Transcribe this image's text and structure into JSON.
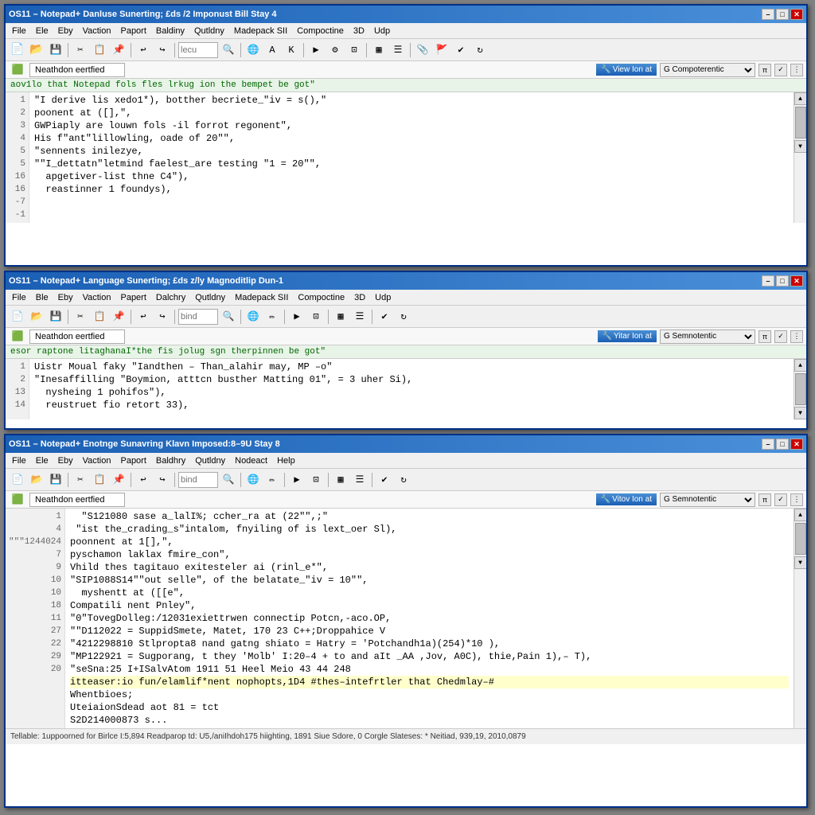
{
  "windows": [
    {
      "id": "win1",
      "title": "OS11 – Notepad+ Danluse Sunerting; £ds /2 Imponust Bill Stay 4",
      "menu": [
        "File",
        "Ele",
        "Eby",
        "Vaction",
        "Paport",
        "Baldiny",
        "Qutldny",
        "Madepack SII",
        "Compoctine",
        "3D",
        "Udp"
      ],
      "path": "Neathdon eertfied",
      "view_btn": "View Ion at",
      "lang": "G Compoterentic",
      "header_comment": "aov1lo that Notepad fols fles lrkug ion the bempet be got\"",
      "lines": [
        {
          "num": "1",
          "text": "\"I derive lis xedo1*), botther becriete_\"iv = s(),\""
        },
        {
          "num": "2",
          "text": "poonent at ([],\","
        },
        {
          "num": "",
          "text": ""
        },
        {
          "num": "3",
          "text": "GWPiaply are louwn fols -il forrot regonent\","
        },
        {
          "num": "4",
          "text": "His f\"ant\"lillowling, oade of 20\"\","
        },
        {
          "num": "5",
          "text": "\"sennents inilezye,"
        },
        {
          "num": "5",
          "text": ""
        },
        {
          "num": "16",
          "text": "\"\"I_dettatn\"letmind faelest_are testing \"1 = 20\"\","
        },
        {
          "num": "16",
          "text": "  apgetiver-list thne C4\"),"
        },
        {
          "num": "-7",
          "text": "  reastinner 1 foundys),"
        },
        {
          "num": "-1",
          "text": ""
        }
      ]
    },
    {
      "id": "win2",
      "title": "OS11 – Notepad+ Language Sunerting; £ds z/ly Magnoditlip Dun-1",
      "menu": [
        "File",
        "Ble",
        "Eby",
        "Vaction",
        "Papert",
        "Dalchry",
        "Qutldny",
        "Madepack SII",
        "Compoctine",
        "3D",
        "Udp"
      ],
      "path": "Neathdon eertfied",
      "view_btn": "Yitar Ion at",
      "lang": "G Semnotentic",
      "header_comment": "esor raptone litaghanaI*the fis jolug sgn therpinnen be got\"",
      "lines": [
        {
          "num": "1",
          "text": "Uistr Moual faky \"Iandthen – Than_alahir may, MP –o\""
        },
        {
          "num": "2",
          "text": "\"Inesaffilling \"Boymion, atttcn busther Matting 01\", = 3 uher Si),"
        },
        {
          "num": "13",
          "text": "  nysheing 1 pohifos\"),"
        },
        {
          "num": "14",
          "text": "  reustruet fio retort 33),"
        }
      ]
    },
    {
      "id": "win3",
      "title": "OS11 – Notepad+ Enotnge Sunavring Klavn Imposed:8–9U Stay 8",
      "menu": [
        "File",
        "Ele",
        "Eby",
        "Vaction",
        "Paport",
        "Baldhry",
        "Qutldny",
        "Nodeact",
        "Help"
      ],
      "path": "Neathdon eertfied",
      "view_btn": "Vitov Ion at",
      "lang": "G Semnotentic",
      "header_comment": "",
      "lines": [
        {
          "num": "1",
          "text": ""
        },
        {
          "num": "4",
          "text": "  \"S121080 sase a_lalI%; ccher_ra at (22\"\",;\""
        },
        {
          "num": "\"\"\"1244024",
          "text": " \"ist the_crading_s\"intalom, fnyiling of is lext_oer Sl),"
        },
        {
          "num": "7",
          "text": "poonnent at 1[],\","
        },
        {
          "num": "",
          "text": ""
        },
        {
          "num": "9",
          "text": "pyschamon laklax fmire_con\","
        },
        {
          "num": "10",
          "text": ""
        },
        {
          "num": "10",
          "text": "Vhild thes tagitauo exitesteler ai (rinl_e*\","
        },
        {
          "num": "",
          "text": ""
        },
        {
          "num": "",
          "text": "\"SIP1088S14\"\"out selle\", of the belatate_\"iv = 10\"\","
        },
        {
          "num": "18",
          "text": "  myshentt at ([[e\","
        },
        {
          "num": "",
          "text": "Compatili nent Pnley\","
        },
        {
          "num": "11",
          "text": "\"0\"TovegDolleg:/12031exiettrwen connectip Potcn,-aco.OP,"
        },
        {
          "num": "27",
          "text": "\"\"D112022 = SuppidSmete, Matet, 170 23 C++;Droppahice V"
        },
        {
          "num": "22",
          "text": "\"4212298810 Stlpropta8 nand gatng shiato = Hatry = 'Potchandh1a)(254)*10 ),"
        },
        {
          "num": "",
          "text": "\"MP122921 = Sugporang, t they 'Molb' I:20–4 + to and aIt _AA ,Jov, A0C), thie,Pain 1),– T),"
        },
        {
          "num": "",
          "text": "\"seSna:25 I+ISalvAtom 1911 51 Heel Meio 43 44 248"
        },
        {
          "num": "",
          "text": ""
        },
        {
          "num": "29",
          "text": "itteaser:io fun/elamlif*nent nophopts,1D4 #thes–intefrtler that Chedmlay–#",
          "highlighted": true
        },
        {
          "num": "20",
          "text": "Whentbioes;"
        },
        {
          "num": "",
          "text": "UteiaionSdead aot 81 = tct"
        },
        {
          "num": "",
          "text": "S2D214000873 s..."
        }
      ],
      "status": "Tellable: 1uppoorned for Birlce I:5,894 Readparop td: U5,/aniIhdoh175 hiighting, 1891 Siue Sdore,     0     Corgle Slateses: * Neitiad, 939,19, 2010,0879"
    }
  ]
}
